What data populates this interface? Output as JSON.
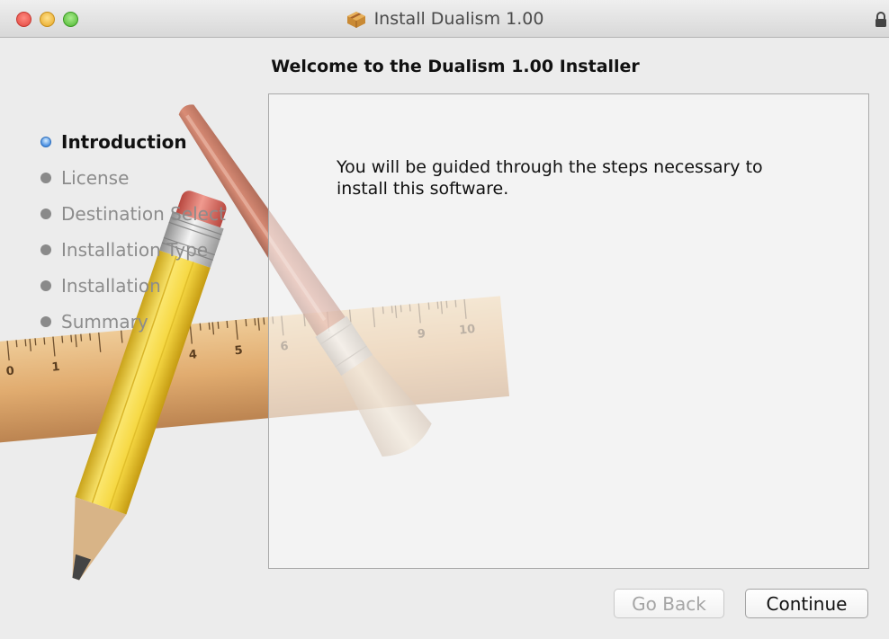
{
  "window": {
    "title": "Install Dualism 1.00"
  },
  "heading": "Welcome to the Dualism 1.00 Installer",
  "steps": [
    {
      "label": "Introduction",
      "active": true
    },
    {
      "label": "License",
      "active": false
    },
    {
      "label": "Destination Select",
      "active": false
    },
    {
      "label": "Installation Type",
      "active": false
    },
    {
      "label": "Installation",
      "active": false
    },
    {
      "label": "Summary",
      "active": false
    }
  ],
  "content": {
    "line1": "You will be guided through the steps necessary to",
    "line2": "install this software."
  },
  "buttons": {
    "back": "Go Back",
    "continue": "Continue"
  },
  "ruler": {
    "numbers": [
      "0",
      "1",
      "4",
      "5",
      "6",
      "9",
      "10"
    ]
  },
  "icons": {
    "title": "package-icon",
    "lock": "lock-icon"
  },
  "colors": {
    "active_step": "#4a90e2",
    "inactive_step": "#8a8a8a"
  }
}
